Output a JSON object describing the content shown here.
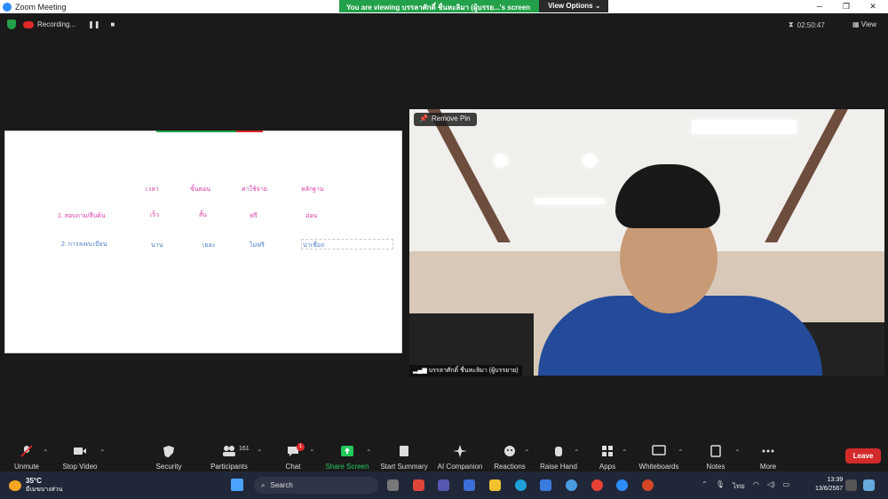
{
  "window": {
    "title": "Zoom Meeting",
    "minimize": "─",
    "maximize": "❐",
    "close": "✕"
  },
  "banner": {
    "text": "You are viewing บรรลาศักดิ์ ชื่นหะลิมา (ผู้บรรย...'s screen",
    "view_options": "View Options ⌄"
  },
  "status": {
    "recording": "Recording...",
    "pause": "❚❚",
    "stop": "■",
    "timer": "02:50:47",
    "view": "View"
  },
  "slide": {
    "headers": [
      "เวลา",
      "ขั้นตอน",
      "ค่าใช้จ่าย",
      "หลักฐาน"
    ],
    "row1": {
      "label": "1. สอบถาม/สืบค้น",
      "values": [
        "เร็ว",
        "สั้น",
        "ฟรี",
        "อ่อน"
      ]
    },
    "row2": {
      "label": "2. การลงทะเบียน",
      "values": [
        "นาน",
        "เยอะ",
        "ไม่ฟรี",
        "น่าเชื่อถ"
      ]
    }
  },
  "camera": {
    "remove_pin": "Remove Pin",
    "name": "บรรลาศักดิ์ ชื่นหะลิมา (ผู้บรรยาย)"
  },
  "controls": {
    "unmute": "Unmute",
    "stop_video": "Stop Video",
    "security": "Security",
    "participants": "Participants",
    "participants_count": "161",
    "chat": "Chat",
    "chat_badge": "1",
    "share_screen": "Share Screen",
    "start_summary": "Start Summary",
    "ai_companion": "AI Companion",
    "reactions": "Reactions",
    "raise_hand": "Raise Hand",
    "apps": "Apps",
    "whiteboards": "Whiteboards",
    "notes": "Notes",
    "more": "More",
    "leave": "Leave"
  },
  "taskbar": {
    "temp": "35°C",
    "weather": "มีเมฆบางส่วน",
    "search": "Search",
    "lang": "ไทย",
    "time": "13:39",
    "date": "13/6/2567"
  }
}
